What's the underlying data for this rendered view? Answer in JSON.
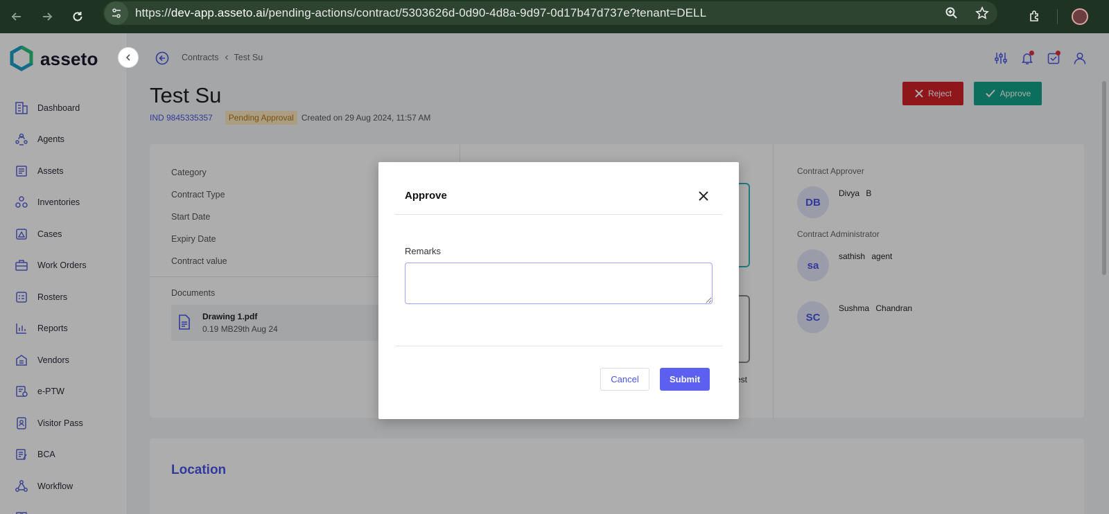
{
  "browser": {
    "url_prefix": "https://",
    "url_host": "dev-app.asseto.ai",
    "url_path": "/pending-actions/contract/5303626d-0d90-4d8a-9d97-0d17b47d737e?tenant=DELL"
  },
  "sidebar": {
    "logo_text": "asseto",
    "items": [
      {
        "label": "Dashboard",
        "icon": "dashboard-icon"
      },
      {
        "label": "Agents",
        "icon": "agents-icon"
      },
      {
        "label": "Assets",
        "icon": "assets-icon"
      },
      {
        "label": "Inventories",
        "icon": "inventories-icon"
      },
      {
        "label": "Cases",
        "icon": "cases-icon"
      },
      {
        "label": "Work Orders",
        "icon": "work-orders-icon"
      },
      {
        "label": "Rosters",
        "icon": "rosters-icon"
      },
      {
        "label": "Reports",
        "icon": "reports-icon"
      },
      {
        "label": "Vendors",
        "icon": "vendors-icon"
      },
      {
        "label": "e-PTW",
        "icon": "eptw-icon"
      },
      {
        "label": "Visitor Pass",
        "icon": "visitor-pass-icon"
      },
      {
        "label": "BCA",
        "icon": "bca-icon"
      },
      {
        "label": "Workflow",
        "icon": "workflow-icon"
      }
    ]
  },
  "breadcrumb": {
    "parent": "Contracts",
    "current": "Test Su"
  },
  "page": {
    "title": "Test Su",
    "id": "IND 9845335357",
    "status": "Pending Approval",
    "created": "Created on 29 Aug 2024, 11:57 AM"
  },
  "actions": {
    "reject_label": "Reject",
    "approve_label": "Approve"
  },
  "details": {
    "fields": [
      "Category",
      "Contract Type",
      "Start Date",
      "Expiry Date",
      "Contract value"
    ],
    "documents_label": "Documents",
    "document": {
      "name": "Drawing 1.pdf",
      "meta": "0.19 MB29th Aug 24"
    },
    "partial_text": "est"
  },
  "people": {
    "approver_label": "Contract Approver",
    "administrator_label": "Contract Administrator",
    "list": [
      {
        "initials": "DB",
        "name": "Divya B"
      },
      {
        "initials": "sa",
        "name": "sathish agent"
      },
      {
        "initials": "SC",
        "name": "Sushma Chandran"
      }
    ]
  },
  "location": {
    "title": "Location"
  },
  "modal": {
    "title": "Approve",
    "remarks_label": "Remarks",
    "remarks_value": "",
    "cancel_label": "Cancel",
    "submit_label": "Submit"
  },
  "colors": {
    "brand": "#4a55e6",
    "reject": "#d3222a",
    "approve": "#12a38a",
    "submit": "#5b60f0",
    "pending_badge_bg": "#fbe7c0",
    "browser_chrome": "#1f3323"
  }
}
